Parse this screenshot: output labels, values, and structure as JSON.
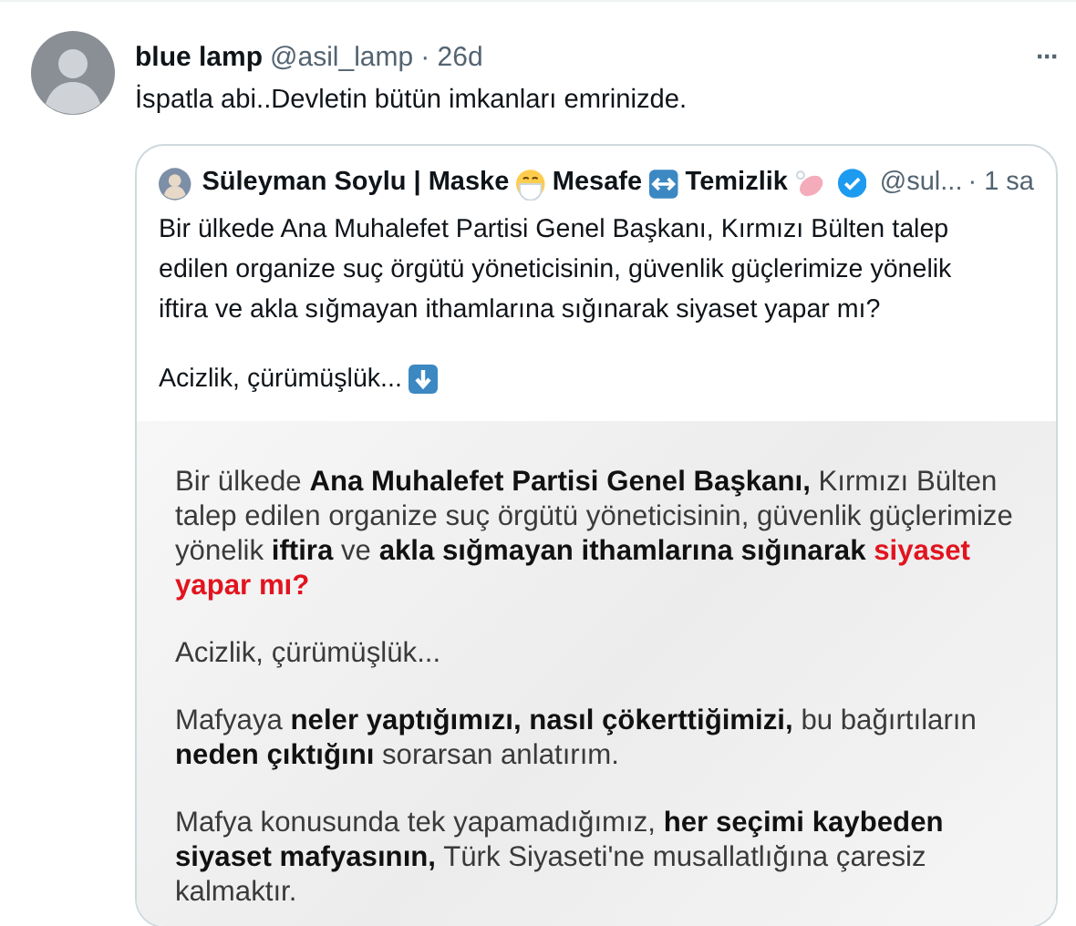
{
  "tweet": {
    "name": "blue lamp",
    "handle": "@asil_lamp",
    "time": "· 26d",
    "text": "İspatla abi..Devletin bütün imkanları emrinizde.",
    "more": "···"
  },
  "quote": {
    "name_parts": [
      {
        "text": "Süleyman Soylu | Maske"
      },
      {
        "text": "Mesafe"
      },
      {
        "text": "Temizlik"
      }
    ],
    "verified": true,
    "handle": "@sul...",
    "time": "· 1 sa",
    "text": "Bir ülkede Ana Muhalefet Partisi Genel Başkanı, Kırmızı Bülten talep edilen organize suç örgütü yöneticisinin, güvenlik güçlerimize yönelik iftira ve akla sığmayan ithamlarına sığınarak siyaset yapar mı?",
    "text_2": "Acizlik, çürümüşlük...",
    "image_paragraphs": [
      {
        "text": "Bir ülkede **Ana Muhalefet Partisi Genel Başkanı,** Kırmızı Bülten talep edilen organize suç örgütü yöneticisinin, güvenlik güçlerimize yönelik **iftira** ve **akla sığmayan ithamlarına sığınarak**",
        "red_tail": "siyaset yapar mı?"
      },
      {
        "text": "Acizlik, çürümüşlük..."
      },
      {
        "text": "Mafyaya **neler yaptığımızı, nasıl çökerttiğimizi,** bu bağırtıların **neden çıktığını** sorarsan anlatırım."
      },
      {
        "text": "Mafya konusunda tek yapamadığımız, **her seçimi kaybeden siyaset mafyasının,** Türk Siyaseti'ne musallatlığına çaresiz kalmaktır."
      }
    ]
  }
}
